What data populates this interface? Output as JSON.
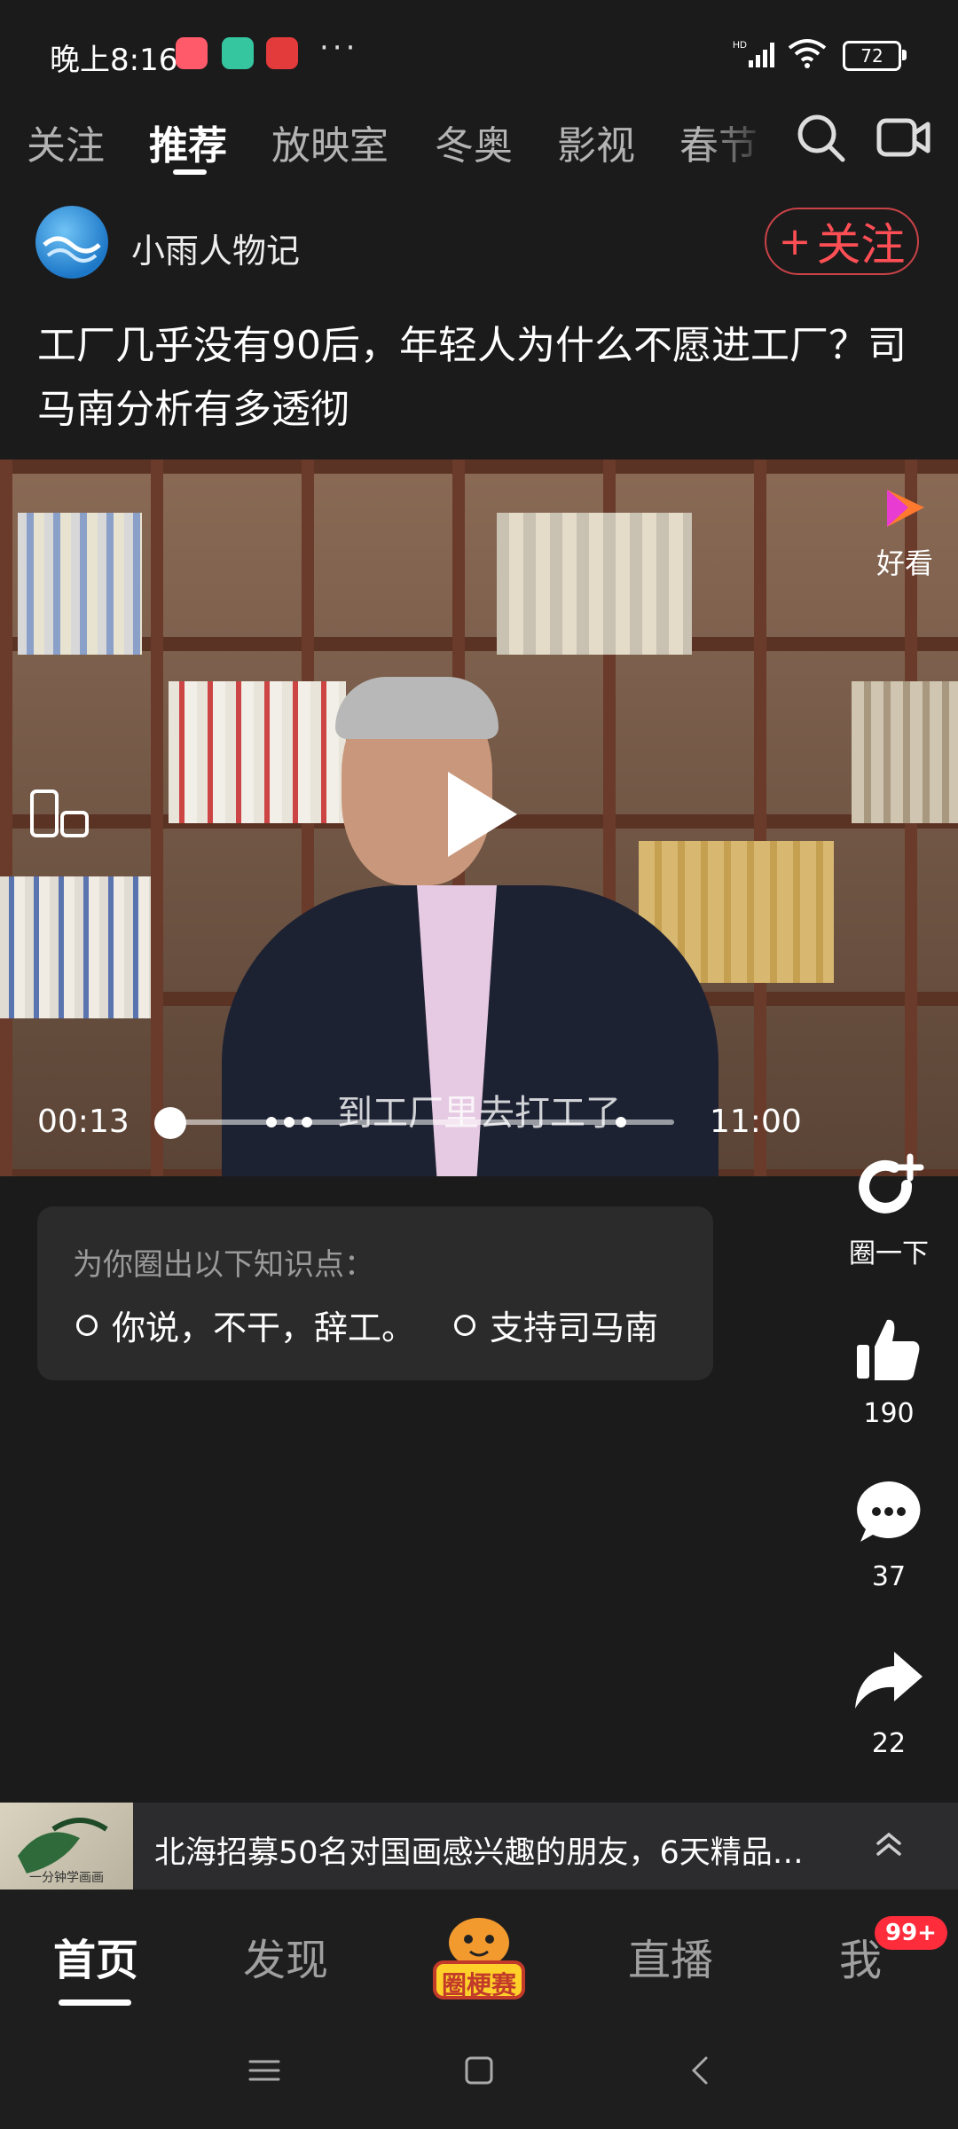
{
  "status_bar": {
    "time": "晚上8:16",
    "more": "···",
    "battery": "72"
  },
  "tabs": [
    {
      "label": "关注",
      "active": false
    },
    {
      "label": "推荐",
      "active": true
    },
    {
      "label": "放映室",
      "active": false
    },
    {
      "label": "冬奥",
      "active": false
    },
    {
      "label": "影视",
      "active": false
    },
    {
      "label": "春节",
      "active": false
    }
  ],
  "author": {
    "name": "小雨人物记",
    "follow_label": "关注",
    "follow_plus": "+"
  },
  "post": {
    "title": "工厂几乎没有90后，年轻人为什么不愿进工厂？司马南分析有多透彻"
  },
  "video": {
    "watermark_label": "好看",
    "subtitle": "到工厂里去打工了",
    "current_time": "00:13",
    "total_time": "11:00",
    "progress": 0.02
  },
  "knowledge": {
    "title": "为你圈出以下知识点：",
    "points": [
      "你说，不干，辞工。",
      "支持司马南"
    ]
  },
  "actions": {
    "circle_label": "圈一下",
    "likes": "190",
    "comments": "37",
    "shares": "22"
  },
  "ad": {
    "text": "北海招募50名对国画感兴趣的朋友，6天精品…",
    "thumb_caption": "一分钟学画画"
  },
  "bottom_nav": {
    "home": "首页",
    "discover": "发现",
    "center_label": "圈梗赛",
    "live": "直播",
    "me": "我",
    "me_badge": "99+"
  },
  "colors": {
    "background": "#1b1b1c",
    "follow_red": "#ff4f55",
    "badge_red": "#ff2c3c"
  }
}
